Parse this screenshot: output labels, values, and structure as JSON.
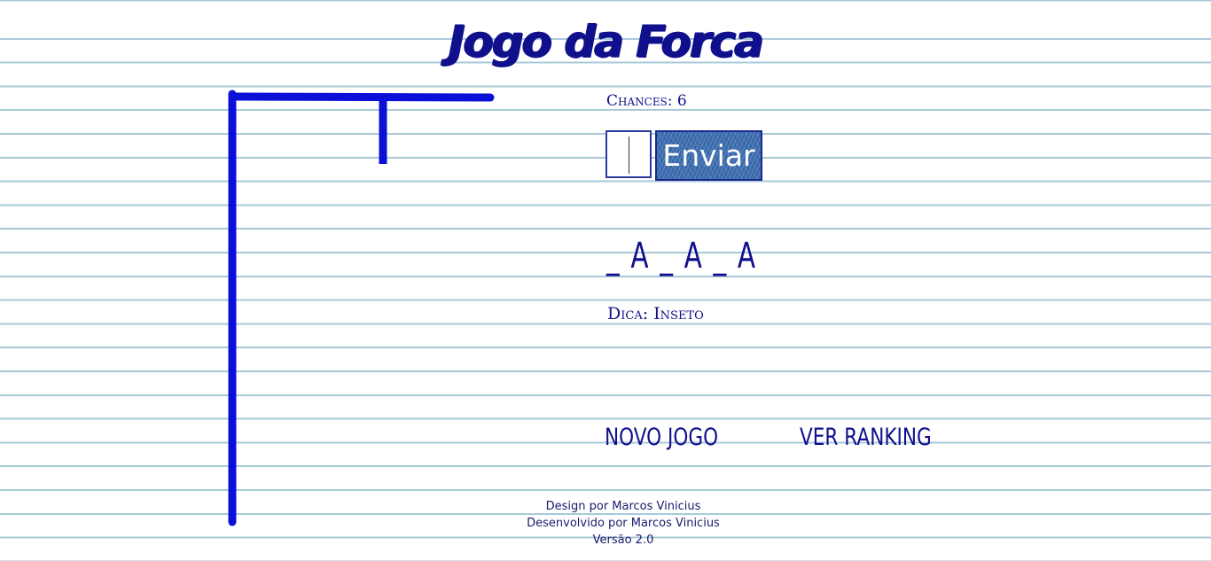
{
  "page": {
    "title": "Jogo da Forca"
  },
  "game": {
    "chances_label": "Chances: 6",
    "guess_value": "",
    "send_label": "Enviar",
    "masked_word": "_ A _ A _ A",
    "hint_label": "Dica:",
    "hint_value": "Inseto",
    "new_game_label": "NOVO JOGO",
    "ranking_label": "VER RANKING",
    "gallows_color": "#0a10d8"
  },
  "footer": {
    "design": "Design por Marcos Vinicius",
    "developed": "Desenvolvido por Marcos Vinicius",
    "version": "Versão 2.0"
  }
}
